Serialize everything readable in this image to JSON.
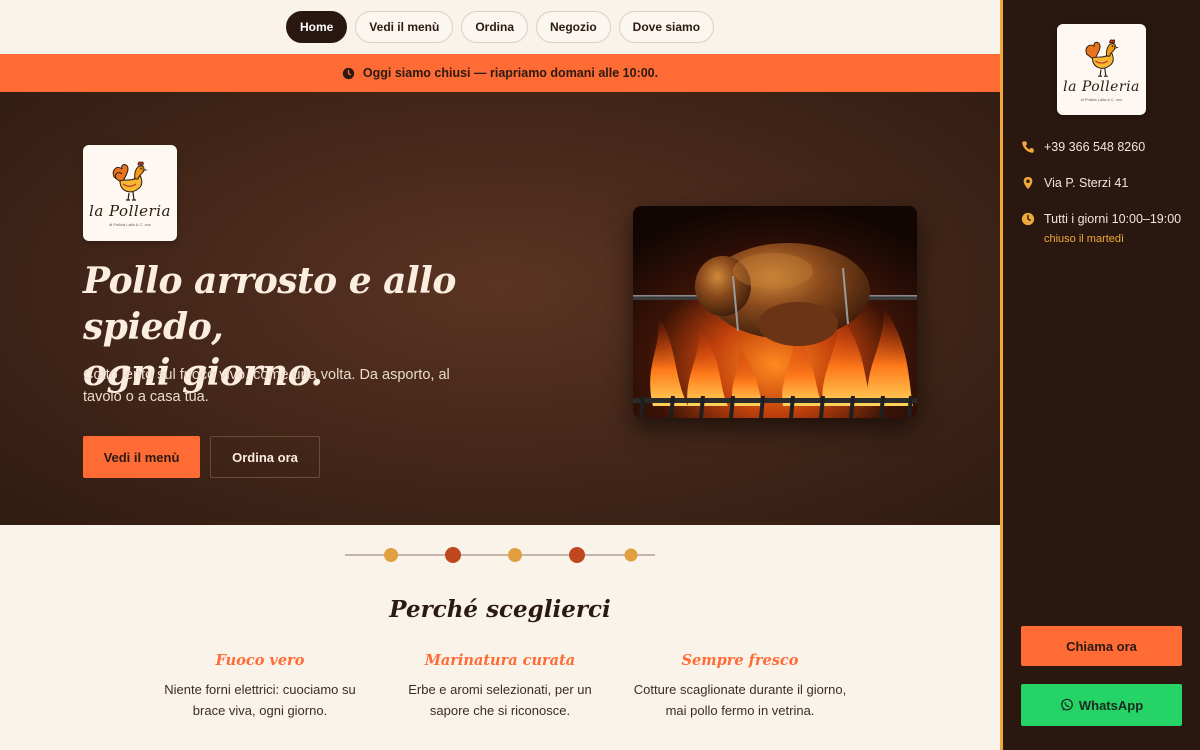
{
  "nav": {
    "items": [
      {
        "label": "Home",
        "active": true
      },
      {
        "label": "Vedi il menù",
        "active": false
      },
      {
        "label": "Ordina",
        "active": false
      },
      {
        "label": "Negozio",
        "active": false
      },
      {
        "label": "Dove siamo",
        "active": false
      }
    ]
  },
  "banner": {
    "icon": "clock-icon",
    "text": "Oggi siamo chiusi — riapriamo domani alle 10:00."
  },
  "brand": {
    "logo_text": "la Polleria",
    "logo_subtext": "di Polizia Lalla & C. snc"
  },
  "hero": {
    "title": "Pollo arrosto e allo spiedo,\nogni giorno.",
    "subtitle": "Cotto lento sul fuoco vivo, come una volta. Da asporto, al tavolo o a casa tua.",
    "primary_button": "Vedi il menù",
    "secondary_button": "Ordina ora"
  },
  "why": {
    "title": "Perché sceglierci",
    "features": [
      {
        "title": "Fuoco vero",
        "text": "Niente forni elettrici: cuociamo su brace viva, ogni giorno."
      },
      {
        "title": "Marinatura curata",
        "text": "Erbe e aromi selezionati, per un sapore che si riconosce."
      },
      {
        "title": "Sempre fresco",
        "text": "Cotture scaglionate durante il giorno, mai pollo fermo in vetrina."
      }
    ]
  },
  "sidebar": {
    "phone": "+39 366 548 8260",
    "address": "Via P. Sterzi 41",
    "hours": "Tutti i giorni 10:00–19:00",
    "hours_note": "chiuso il martedì",
    "call_button": "Chiama ora",
    "whatsapp_button": "WhatsApp"
  },
  "colors": {
    "accent": "#ff6b35",
    "gold": "#f0a83a",
    "dark": "#2a1710",
    "cream": "#faf3ea",
    "whatsapp": "#25d366"
  }
}
